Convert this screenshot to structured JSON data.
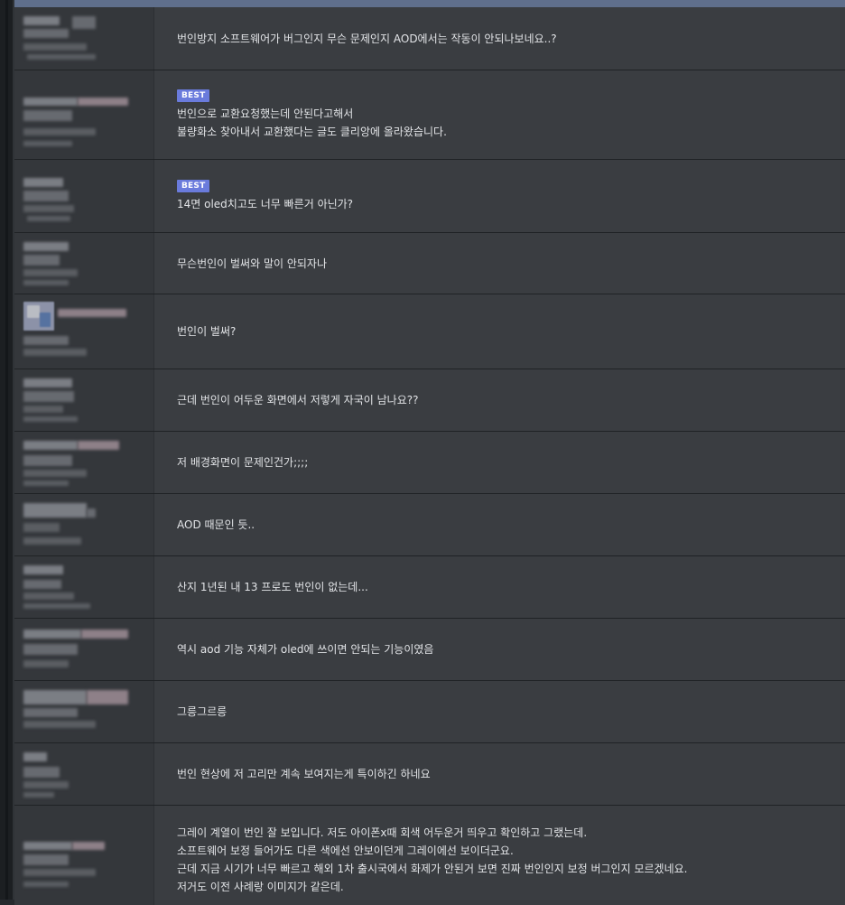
{
  "badge_best": "BEST",
  "comments": [
    {
      "lines": [
        "번인방지 소프트웨어가 버그인지 무슨 문제인지 AOD에서는 작동이 안되나보네요..?"
      ]
    },
    {
      "best": true,
      "lines": [
        "번인으로 교환요청했는데 안된다고해서",
        "불량화소 찾아내서 교환했다는 글도 클리앙에 올라왔습니다."
      ]
    },
    {
      "best": true,
      "lines": [
        "14면 oled치고도 너무 빠른거 아닌가?"
      ]
    },
    {
      "lines": [
        "무슨번인이 벌써와 말이 안되자나"
      ]
    },
    {
      "lines": [
        "번인이 벌써?"
      ]
    },
    {
      "lines": [
        "근데 번인이 어두운 화면에서 저렇게 자국이 남나요??"
      ]
    },
    {
      "lines": [
        "저 배경화면이 문제인건가;;;;"
      ]
    },
    {
      "lines": [
        "AOD 때문인 듯.."
      ]
    },
    {
      "lines": [
        "산지 1년된 내 13 프로도 번인이 없는데..."
      ]
    },
    {
      "lines": [
        "역시 aod 기능 자체가 oled에 쓰이면 안되는 기능이였음"
      ]
    },
    {
      "lines": [
        "그릉그르릉"
      ]
    },
    {
      "lines": [
        "번인 현상에 저 고리만 계속 보여지는게 특이하긴 하네요"
      ]
    },
    {
      "lines": [
        "그레이 계열이 번인 잘 보입니다. 저도 아이폰x때 회색 어두운거 띄우고 확인하고 그랬는데.",
        "소프트웨어 보정 들어가도 다른 색에선 안보이던게 그레이에선 보이더군요.",
        "근데 지금 시기가 너무 빠르고 해외 1차 출시국에서 화제가 안된거 보면 진짜 번인인지 보정 버그인지 모르겠네요.",
        "저거도 이전 사례랑 이미지가 같은데."
      ]
    }
  ]
}
